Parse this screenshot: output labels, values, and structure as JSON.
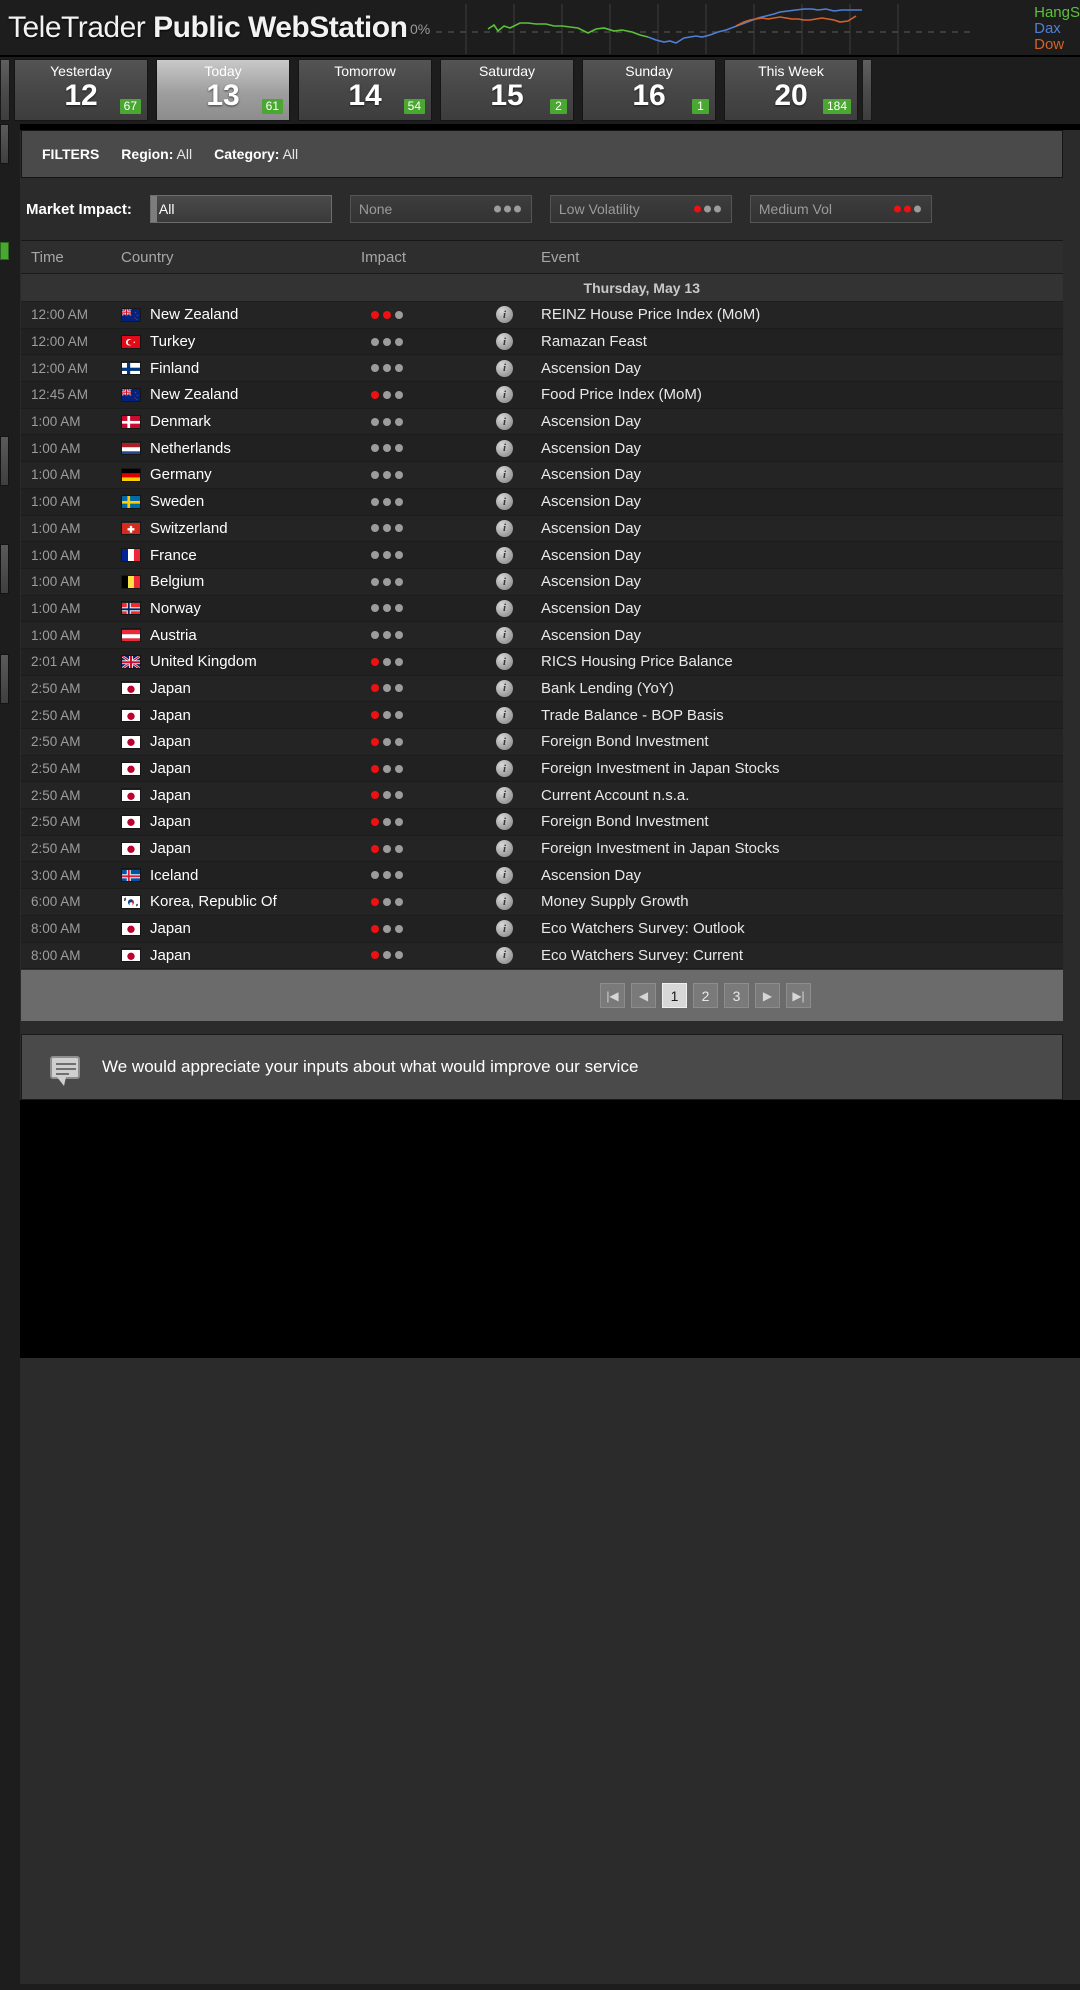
{
  "app": {
    "brand_light": "TeleTrader ",
    "brand_bold": "Public WebStation"
  },
  "ticker": {
    "zero_label": "0%",
    "legend": [
      {
        "name": "HangS",
        "color": "#5bc236"
      },
      {
        "name": "Dax",
        "color": "#4f7fd6"
      },
      {
        "name": "Dow",
        "color": "#d4622a"
      }
    ]
  },
  "chart_data": {
    "type": "line",
    "title": "",
    "xlabel": "",
    "ylabel": "",
    "grid": true,
    "legend_position": "right",
    "annotations": [
      "0%"
    ],
    "series": [
      {
        "name": "HangS",
        "color": "#5bc236",
        "values": [
          0.4,
          1.0,
          0.3,
          0.9,
          0.6,
          1.5,
          1.6,
          1.4,
          1.5,
          1.2,
          1.3,
          1.1,
          0.9,
          0.2,
          0.8,
          0.9,
          0.5,
          0.7,
          0.4,
          -0.2,
          -0.6
        ]
      },
      {
        "name": "Dax",
        "color": "#4f7fd6",
        "values": [
          -0.4,
          -1.6,
          -2.0,
          -1.8,
          -2.2,
          -1.0,
          -0.9,
          -0.7,
          -0.8,
          -0.4,
          0.2,
          0.6,
          1.1,
          1.7,
          2.2,
          2.8,
          3.4,
          4.0,
          4.6,
          5.1,
          5.6,
          6.2,
          6.6,
          7.0,
          7.4,
          7.2,
          7.6,
          7.4,
          7.5
        ]
      },
      {
        "name": "Dow",
        "color": "#d4622a",
        "values": [
          2.0,
          3.0,
          3.6,
          4.0,
          4.3,
          4.2,
          4.5,
          4.6,
          4.4,
          4.2,
          4.3,
          4.1,
          4.0,
          4.2,
          4.4,
          4.2,
          4.0,
          3.6,
          3.8,
          4.8
        ]
      }
    ]
  },
  "day_tabs": [
    {
      "label": "Yesterday",
      "day": "12",
      "count": "67",
      "active": false
    },
    {
      "label": "Today",
      "day": "13",
      "count": "61",
      "active": true
    },
    {
      "label": "Tomorrow",
      "day": "14",
      "count": "54",
      "active": false
    },
    {
      "label": "Saturday",
      "day": "15",
      "count": "2",
      "active": false
    },
    {
      "label": "Sunday",
      "day": "16",
      "count": "1",
      "active": false
    },
    {
      "label": "This Week",
      "day": "20",
      "count": "184",
      "active": false
    }
  ],
  "filters": {
    "title": "FILTERS",
    "region_label": "Region:",
    "region_value": "All",
    "category_label": "Category:",
    "category_value": "All"
  },
  "market_impact": {
    "label": "Market Impact:",
    "options": [
      {
        "text": "All",
        "selected": true,
        "dots": 0
      },
      {
        "text": "None",
        "selected": false,
        "dots": 0
      },
      {
        "text": "Low Volatility",
        "selected": false,
        "dots": 1
      },
      {
        "text": "Medium Vol",
        "selected": false,
        "dots": 2
      }
    ]
  },
  "table": {
    "columns": [
      "Time",
      "Country",
      "Impact",
      "Event"
    ],
    "date_group": "Thursday, May 13",
    "rows": [
      {
        "time": "12:00 AM",
        "country": "New Zealand",
        "flag": "nz",
        "impact": 2,
        "event": "REINZ House Price Index (MoM)"
      },
      {
        "time": "12:00 AM",
        "country": "Turkey",
        "flag": "tr",
        "impact": 0,
        "event": "Ramazan Feast"
      },
      {
        "time": "12:00 AM",
        "country": "Finland",
        "flag": "fi",
        "impact": 0,
        "event": "Ascension Day"
      },
      {
        "time": "12:45 AM",
        "country": "New Zealand",
        "flag": "nz",
        "impact": 1,
        "event": "Food Price Index (MoM)"
      },
      {
        "time": "1:00 AM",
        "country": "Denmark",
        "flag": "dk",
        "impact": 0,
        "event": "Ascension Day"
      },
      {
        "time": "1:00 AM",
        "country": "Netherlands",
        "flag": "nl",
        "impact": 0,
        "event": "Ascension Day"
      },
      {
        "time": "1:00 AM",
        "country": "Germany",
        "flag": "de",
        "impact": 0,
        "event": "Ascension Day"
      },
      {
        "time": "1:00 AM",
        "country": "Sweden",
        "flag": "se",
        "impact": 0,
        "event": "Ascension Day"
      },
      {
        "time": "1:00 AM",
        "country": "Switzerland",
        "flag": "ch",
        "impact": 0,
        "event": "Ascension Day"
      },
      {
        "time": "1:00 AM",
        "country": "France",
        "flag": "fr",
        "impact": 0,
        "event": "Ascension Day"
      },
      {
        "time": "1:00 AM",
        "country": "Belgium",
        "flag": "be",
        "impact": 0,
        "event": "Ascension Day"
      },
      {
        "time": "1:00 AM",
        "country": "Norway",
        "flag": "no",
        "impact": 0,
        "event": "Ascension Day"
      },
      {
        "time": "1:00 AM",
        "country": "Austria",
        "flag": "at",
        "impact": 0,
        "event": "Ascension Day"
      },
      {
        "time": "2:01 AM",
        "country": "United Kingdom",
        "flag": "uk",
        "impact": 1,
        "event": "RICS Housing Price Balance"
      },
      {
        "time": "2:50 AM",
        "country": "Japan",
        "flag": "jp",
        "impact": 1,
        "event": "Bank Lending (YoY)"
      },
      {
        "time": "2:50 AM",
        "country": "Japan",
        "flag": "jp",
        "impact": 1,
        "event": "Trade Balance - BOP Basis"
      },
      {
        "time": "2:50 AM",
        "country": "Japan",
        "flag": "jp",
        "impact": 1,
        "event": "Foreign Bond Investment"
      },
      {
        "time": "2:50 AM",
        "country": "Japan",
        "flag": "jp",
        "impact": 1,
        "event": "Foreign Investment in Japan Stocks"
      },
      {
        "time": "2:50 AM",
        "country": "Japan",
        "flag": "jp",
        "impact": 1,
        "event": "Current Account n.s.a."
      },
      {
        "time": "2:50 AM",
        "country": "Japan",
        "flag": "jp",
        "impact": 1,
        "event": "Foreign Bond Investment"
      },
      {
        "time": "2:50 AM",
        "country": "Japan",
        "flag": "jp",
        "impact": 1,
        "event": "Foreign Investment in Japan Stocks"
      },
      {
        "time": "3:00 AM",
        "country": "Iceland",
        "flag": "is",
        "impact": 0,
        "event": "Ascension Day"
      },
      {
        "time": "6:00 AM",
        "country": "Korea, Republic Of",
        "flag": "kr",
        "impact": 1,
        "event": "Money Supply Growth"
      },
      {
        "time": "8:00 AM",
        "country": "Japan",
        "flag": "jp",
        "impact": 1,
        "event": "Eco Watchers Survey: Outlook"
      },
      {
        "time": "8:00 AM",
        "country": "Japan",
        "flag": "jp",
        "impact": 1,
        "event": "Eco Watchers Survey: Current"
      }
    ]
  },
  "pager": {
    "first": "|◀",
    "prev": "◀",
    "pages": [
      "1",
      "2",
      "3"
    ],
    "current": "1",
    "next": "▶",
    "last": "▶|"
  },
  "feedback": {
    "text": "We would appreciate your inputs about what would improve our service"
  },
  "colors": {
    "accent_green": "#4aa832",
    "impact_red": "#ee1111",
    "panel_bg": "#2b2b2b"
  }
}
